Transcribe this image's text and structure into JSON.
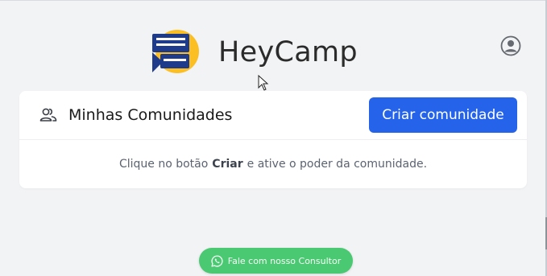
{
  "brand": {
    "name": "HeyCamp",
    "logo_icon": "chat-bubble-logo-icon"
  },
  "header": {
    "profile_icon": "user-circle-icon"
  },
  "communities": {
    "title": "Minhas Comunidades",
    "icon": "users-icon",
    "create_button_label": "Criar comunidade",
    "empty_message_prefix": "Clique no botão",
    "empty_message_emphasis": "Criar",
    "empty_message_suffix": "e ative o poder da comunidade."
  },
  "contact": {
    "label": "Fale com nosso Consultor",
    "icon": "whatsapp-icon"
  },
  "colors": {
    "primary": "#2563eb",
    "whatsapp": "#4bc972",
    "logo_blue": "#1e3a8a",
    "logo_yellow": "#fbbf24",
    "background": "#f2f3f5"
  }
}
